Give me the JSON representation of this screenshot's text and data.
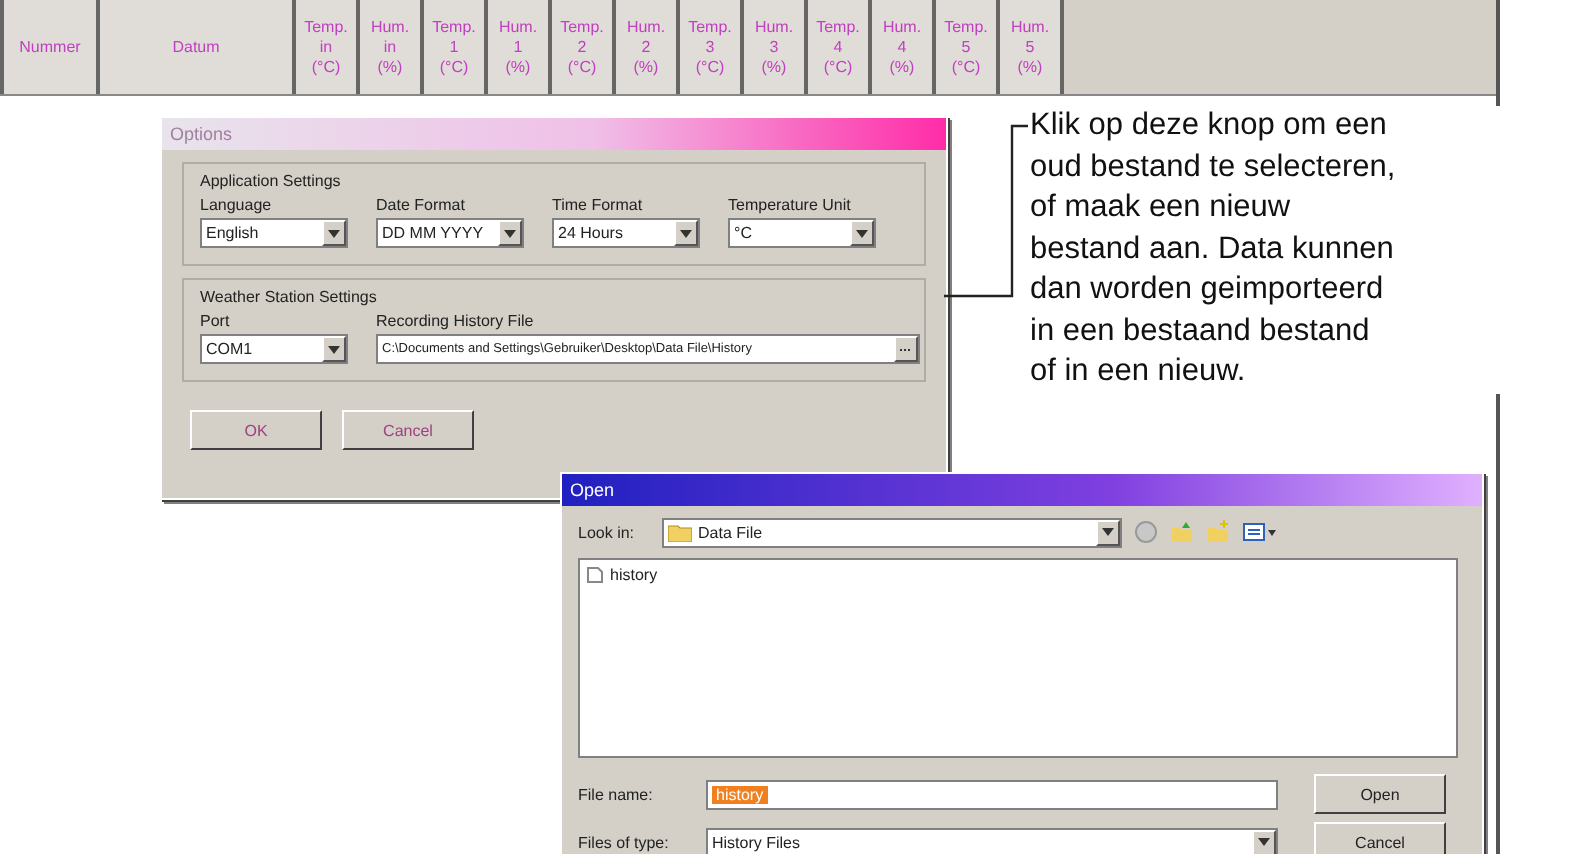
{
  "table": {
    "columns": [
      {
        "lines": [
          "Nummer"
        ]
      },
      {
        "lines": [
          "Datum"
        ]
      },
      {
        "lines": [
          "Temp.",
          "in",
          "(°C)"
        ]
      },
      {
        "lines": [
          "Hum.",
          "in",
          "(%)"
        ]
      },
      {
        "lines": [
          "Temp.",
          "1",
          "(°C)"
        ]
      },
      {
        "lines": [
          "Hum.",
          "1",
          "(%)"
        ]
      },
      {
        "lines": [
          "Temp.",
          "2",
          "(°C)"
        ]
      },
      {
        "lines": [
          "Hum.",
          "2",
          "(%)"
        ]
      },
      {
        "lines": [
          "Temp.",
          "3",
          "(°C)"
        ]
      },
      {
        "lines": [
          "Hum.",
          "3",
          "(%)"
        ]
      },
      {
        "lines": [
          "Temp.",
          "4",
          "(°C)"
        ]
      },
      {
        "lines": [
          "Hum.",
          "4",
          "(%)"
        ]
      },
      {
        "lines": [
          "Temp.",
          "5",
          "(°C)"
        ]
      },
      {
        "lines": [
          "Hum.",
          "5",
          "(%)"
        ]
      }
    ]
  },
  "options_dialog": {
    "title": "Options",
    "application_settings": {
      "title": "Application Settings",
      "fields": [
        {
          "label": "Language",
          "value": "English"
        },
        {
          "label": "Date Format",
          "value": "DD MM YYYY"
        },
        {
          "label": "Time Format",
          "value": "24 Hours"
        },
        {
          "label": "Temperature Unit",
          "value": "°C"
        }
      ]
    },
    "weather_station_settings": {
      "title": "Weather Station Settings",
      "port": {
        "label": "Port",
        "value": "COM1"
      },
      "history_file": {
        "label": "Recording History File",
        "value": "C:\\Documents and Settings\\Gebruiker\\Desktop\\Data File\\History"
      }
    },
    "buttons": [
      "OK",
      "Cancel"
    ]
  },
  "open_dialog": {
    "title": "Open",
    "look_in_label": "Look in:",
    "folder": "Data File",
    "files": [
      "history"
    ],
    "file_name_label": "File name:",
    "file_name": "history",
    "file_type_label": "Files of type:",
    "file_type": "History Files",
    "buttons": [
      "Open",
      "Cancel"
    ]
  },
  "callout": {
    "text": "Klik op deze knop om een\noud bestand te selecteren,\nof maak een nieuw\nbestand aan. Data kunnen\ndan worden geimporteerd\nin een bestaand bestand\nof in een nieuw."
  }
}
